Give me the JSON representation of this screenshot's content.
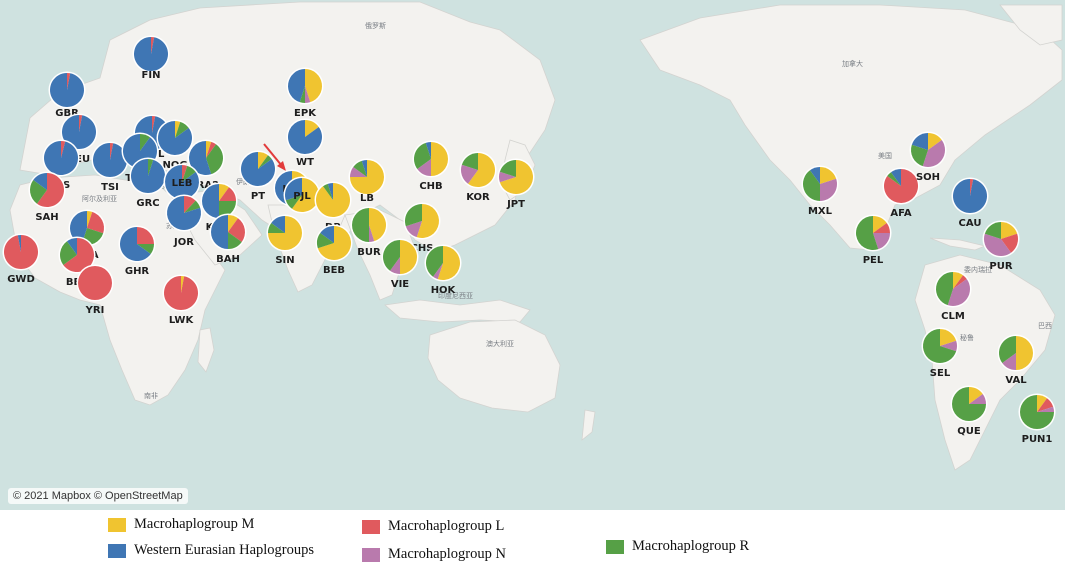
{
  "attribution": "© 2021 Mapbox © OpenStreetMap",
  "map_texts": [
    "俄罗斯",
    "加拿大",
    "美国",
    "阿尔及利亚",
    "伊朗",
    "印度尼西亚",
    "澳大利亚",
    "南非",
    "委内瑞拉",
    "巴西",
    "秘鲁",
    "埃及",
    "苏丹"
  ],
  "colors": {
    "M": "#f0c430",
    "L": "#e05a5e",
    "N": "#b97aad",
    "R": "#56a046",
    "W": "#3f76b4"
  },
  "legend": [
    {
      "key": "M",
      "label": "Macrohaplogroup M"
    },
    {
      "key": "W",
      "label": "Western Eurasian Haplogroups"
    },
    {
      "key": "L",
      "label": "Macrohaplogroup L"
    },
    {
      "key": "N",
      "label": "Macrohaplogroup N"
    },
    {
      "key": "R",
      "label": "Macrohaplogroup R"
    }
  ],
  "populations": [
    {
      "name": "FIN",
      "lat": 62,
      "lon": 26,
      "comp": {
        "W": 97,
        "L": 3
      }
    },
    {
      "name": "GBR",
      "lat": 53,
      "lon": -1,
      "comp": {
        "W": 97,
        "L": 3
      }
    },
    {
      "name": "CEU",
      "lat": 50,
      "lon": 8,
      "comp": {
        "W": 97,
        "L": 3
      }
    },
    {
      "name": "IBS",
      "lat": 41,
      "lon": -4,
      "comp": {
        "W": 96,
        "L": 4
      }
    },
    {
      "name": "TSI",
      "lat": 43,
      "lon": 12,
      "comp": {
        "W": 97,
        "L": 3
      }
    },
    {
      "name": "MOL",
      "lat": 47,
      "lon": 28,
      "comp": {
        "W": 97,
        "L": 3
      }
    },
    {
      "name": "NOG",
      "lat": 45,
      "lon": 44,
      "comp": {
        "W": 85,
        "M": 5,
        "R": 10
      }
    },
    {
      "name": "TUR1",
      "lat": 39,
      "lon": 33,
      "comp": {
        "W": 90,
        "R": 10
      }
    },
    {
      "name": "GRC",
      "lat": 38,
      "lon": 23,
      "comp": {
        "W": 95,
        "R": 5
      }
    },
    {
      "name": "IRA2",
      "lat": 35,
      "lon": 52,
      "comp": {
        "W": 55,
        "R": 35,
        "M": 5,
        "L": 5
      }
    },
    {
      "name": "LEB",
      "lat": 33,
      "lon": 35,
      "comp": {
        "W": 85,
        "R": 10,
        "L": 5
      }
    },
    {
      "name": "JOR",
      "lat": 31,
      "lon": 36,
      "comp": {
        "W": 80,
        "L": 12,
        "R": 8
      }
    },
    {
      "name": "KUW",
      "lat": 29,
      "lon": 48,
      "comp": {
        "W": 50,
        "R": 25,
        "M": 10,
        "L": 15
      }
    },
    {
      "name": "BAH",
      "lat": 26,
      "lon": 51,
      "comp": {
        "W": 50,
        "L": 25,
        "R": 15,
        "M": 10
      }
    },
    {
      "name": "SAH",
      "lat": 26,
      "lon": -12,
      "comp": {
        "L": 60,
        "R": 25,
        "W": 15
      }
    },
    {
      "name": "GWD",
      "lat": 13,
      "lon": -16,
      "comp": {
        "L": 97,
        "W": 3
      }
    },
    {
      "name": "ARA",
      "lat": 24,
      "lon": 45,
      "comp": {
        "W": 45,
        "R": 25,
        "L": 25,
        "M": 5
      }
    },
    {
      "name": "BER",
      "lat": 32,
      "lon": -6,
      "comp": {
        "L": 65,
        "R": 25,
        "W": 10
      }
    },
    {
      "name": "YRI",
      "lat": 7,
      "lon": 4,
      "comp": {
        "L": 100
      }
    },
    {
      "name": "GHR",
      "lat": 15,
      "lon": 38,
      "comp": {
        "W": 65,
        "L": 25,
        "R": 10
      }
    },
    {
      "name": "LWK",
      "lat": 0,
      "lon": 37,
      "comp": {
        "L": 97,
        "M": 3
      }
    },
    {
      "name": "PT",
      "lat": 36,
      "lon": 58,
      "comp": {
        "W": 85,
        "M": 10,
        "R": 5
      }
    },
    {
      "name": "EPK",
      "lat": 63,
      "lon": 96,
      "comp": {
        "W": 45,
        "M": 45,
        "N": 5,
        "R": 5
      }
    },
    {
      "name": "WT",
      "lat": 50,
      "lon": 90,
      "comp": {
        "W": 85,
        "M": 15
      }
    },
    {
      "name": "KIR",
      "lat": 42,
      "lon": 75,
      "comp": {
        "W": 50,
        "M": 40,
        "R": 10
      }
    },
    {
      "name": "PJL",
      "lat": 31,
      "lon": 74,
      "comp": {
        "M": 60,
        "W": 30,
        "R": 10
      }
    },
    {
      "name": "DB",
      "lat": 30,
      "lon": 82,
      "comp": {
        "M": 90,
        "W": 5,
        "R": 5
      }
    },
    {
      "name": "SIN",
      "lat": 22,
      "lon": 70,
      "comp": {
        "M": 75,
        "R": 10,
        "W": 15
      }
    },
    {
      "name": "BEB",
      "lat": 22,
      "lon": 88,
      "comp": {
        "M": 70,
        "W": 15,
        "R": 15
      }
    },
    {
      "name": "LB",
      "lat": 34,
      "lon": 94,
      "comp": {
        "M": 75,
        "R": 10,
        "N": 10,
        "W": 5
      }
    },
    {
      "name": "CHB",
      "lat": 38,
      "lon": 115,
      "comp": {
        "M": 50,
        "R": 30,
        "N": 15,
        "W": 5
      }
    },
    {
      "name": "KOR",
      "lat": 37,
      "lon": 130,
      "comp": {
        "M": 60,
        "R": 20,
        "N": 20
      }
    },
    {
      "name": "JPT",
      "lat": 36,
      "lon": 140,
      "comp": {
        "M": 70,
        "R": 20,
        "N": 10
      }
    },
    {
      "name": "BUR",
      "lat": 22,
      "lon": 96,
      "comp": {
        "R": 50,
        "M": 45,
        "N": 5
      }
    },
    {
      "name": "CHS",
      "lat": 30,
      "lon": 113,
      "comp": {
        "M": 55,
        "R": 30,
        "N": 15
      }
    },
    {
      "name": "VIE",
      "lat": 20,
      "lon": 104,
      "comp": {
        "M": 50,
        "R": 40,
        "N": 10
      }
    },
    {
      "name": "HOK",
      "lat": 23,
      "lon": 116,
      "comp": {
        "M": 55,
        "R": 40,
        "N": 5
      }
    },
    {
      "name": "MXL",
      "lat": 24,
      "lon": -104,
      "comp": {
        "R": 40,
        "N": 30,
        "M": 20,
        "W": 10
      }
    },
    {
      "name": "AFA",
      "lat": 25,
      "lon": -85,
      "comp": {
        "L": 85,
        "W": 10,
        "R": 5
      }
    },
    {
      "name": "SOH",
      "lat": 38,
      "lon": -77,
      "comp": {
        "N": 40,
        "M": 15,
        "W": 20,
        "R": 25
      }
    },
    {
      "name": "CAU",
      "lat": 40,
      "lon": -78,
      "comp": {
        "W": 97,
        "L": 3
      }
    },
    {
      "name": "PEL",
      "lat": 16,
      "lon": -92,
      "comp": {
        "R": 55,
        "N": 20,
        "M": 15,
        "L": 10
      }
    },
    {
      "name": "PUR",
      "lat": 18,
      "lon": -66,
      "comp": {
        "N": 40,
        "M": 20,
        "L": 20,
        "R": 20
      }
    },
    {
      "name": "CLM",
      "lat": 4,
      "lon": -74,
      "comp": {
        "N": 40,
        "R": 45,
        "M": 10,
        "L": 5
      }
    },
    {
      "name": "SEL",
      "lat": -8,
      "lon": -76,
      "comp": {
        "R": 70,
        "M": 20,
        "N": 10
      }
    },
    {
      "name": "VAL",
      "lat": -12,
      "lon": -50,
      "comp": {
        "M": 50,
        "R": 35,
        "N": 15
      }
    },
    {
      "name": "QUE",
      "lat": -20,
      "lon": -66,
      "comp": {
        "R": 75,
        "M": 15,
        "N": 10
      }
    },
    {
      "name": "PUN1",
      "lat": -24,
      "lon": -50,
      "comp": {
        "R": 75,
        "L": 10,
        "M": 10,
        "N": 5
      }
    }
  ]
}
